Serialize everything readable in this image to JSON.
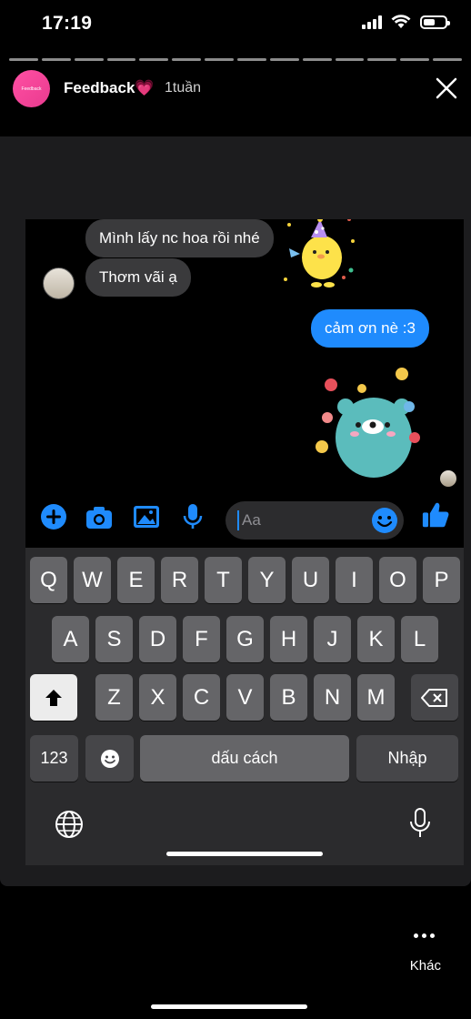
{
  "status_bar": {
    "time": "17:19"
  },
  "story": {
    "title": "Feedback💗",
    "time_ago": "1tuần",
    "avatar_text": "Feedback",
    "progress_segments": 14
  },
  "chat": {
    "messages": [
      {
        "text": "Mình lấy nc hoa rồi nhé",
        "direction": "incoming"
      },
      {
        "text": "Thơm vãi ạ",
        "direction": "incoming"
      },
      {
        "text": "cảm ơn nè :3",
        "direction": "outgoing"
      }
    ],
    "stickers": [
      "party-chick-sticker",
      "teal-bear-flowers-sticker"
    ]
  },
  "composer": {
    "placeholder": "Aa",
    "icons": [
      "add-icon",
      "camera-icon",
      "gallery-icon",
      "microphone-icon",
      "emoji-icon",
      "like-icon"
    ]
  },
  "keyboard": {
    "row1": [
      "Q",
      "W",
      "E",
      "R",
      "T",
      "Y",
      "U",
      "I",
      "O",
      "P"
    ],
    "row2": [
      "A",
      "S",
      "D",
      "F",
      "G",
      "H",
      "J",
      "K",
      "L"
    ],
    "row3": [
      "Z",
      "X",
      "C",
      "V",
      "B",
      "N",
      "M"
    ],
    "numbers_label": "123",
    "space_label": "dấu cách",
    "return_label": "Nhập"
  },
  "footer": {
    "more_label": "Khác"
  },
  "colors": {
    "accent_blue": "#1f8bfd",
    "incoming_bubble": "#3a3a3c",
    "story_pink": "#ff4fa3"
  }
}
